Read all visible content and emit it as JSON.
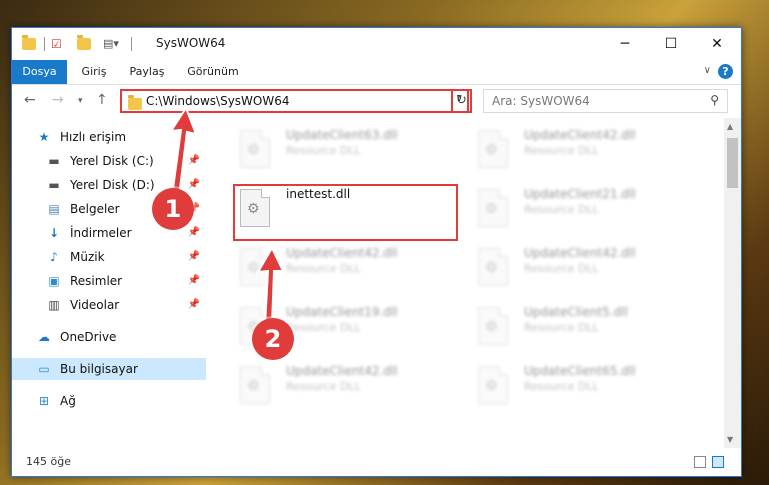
{
  "window": {
    "title": "SysWOW64"
  },
  "ribbon": {
    "tabs": [
      "Dosya",
      "Giriş",
      "Paylaş",
      "Görünüm"
    ]
  },
  "address": {
    "path": "C:\\Windows\\SysWOW64"
  },
  "search": {
    "placeholder": "Ara: SysWOW64"
  },
  "nav": {
    "quick_access": "Hızlı erişim",
    "items": [
      {
        "label": "Yerel Disk (C:)",
        "icon": "drive-icon"
      },
      {
        "label": "Yerel Disk (D:)",
        "icon": "drive-icon"
      },
      {
        "label": "Belgeler",
        "icon": "documents-icon"
      },
      {
        "label": "İndirmeler",
        "icon": "download-icon"
      },
      {
        "label": "Müzik",
        "icon": "music-icon"
      },
      {
        "label": "Resimler",
        "icon": "pictures-icon"
      },
      {
        "label": "Videolar",
        "icon": "videos-icon"
      }
    ],
    "onedrive": "OneDrive",
    "this_pc": "Bu bilgisayar",
    "network": "Ağ"
  },
  "files": {
    "left": [
      {
        "name": "UpdateClient63.dll",
        "type": "Resource DLL",
        "blurred": true
      },
      {
        "name": "inettest.dll",
        "type": "",
        "blurred": false
      },
      {
        "name": "UpdateClient42.dll",
        "type": "Resource DLL",
        "blurred": true
      },
      {
        "name": "UpdateClient19.dll",
        "type": "Resource DLL",
        "blurred": true
      },
      {
        "name": "UpdateClient42.dll",
        "type": "Resource DLL",
        "blurred": true
      }
    ],
    "right": [
      {
        "name": "UpdateClient42.dll",
        "type": "Resource DLL",
        "blurred": true
      },
      {
        "name": "UpdateClient21.dll",
        "type": "Resource DLL",
        "blurred": true
      },
      {
        "name": "UpdateClient42.dll",
        "type": "Resource DLL",
        "blurred": true
      },
      {
        "name": "UpdateClient5.dll",
        "type": "Resource DLL",
        "blurred": true
      },
      {
        "name": "UpdateClient65.dll",
        "type": "Resource DLL",
        "blurred": true
      }
    ]
  },
  "status": {
    "count": "145 öğe"
  },
  "callouts": [
    "1",
    "2"
  ],
  "colors": {
    "accent": "#1979ca",
    "annotation": "#e03c3c"
  }
}
